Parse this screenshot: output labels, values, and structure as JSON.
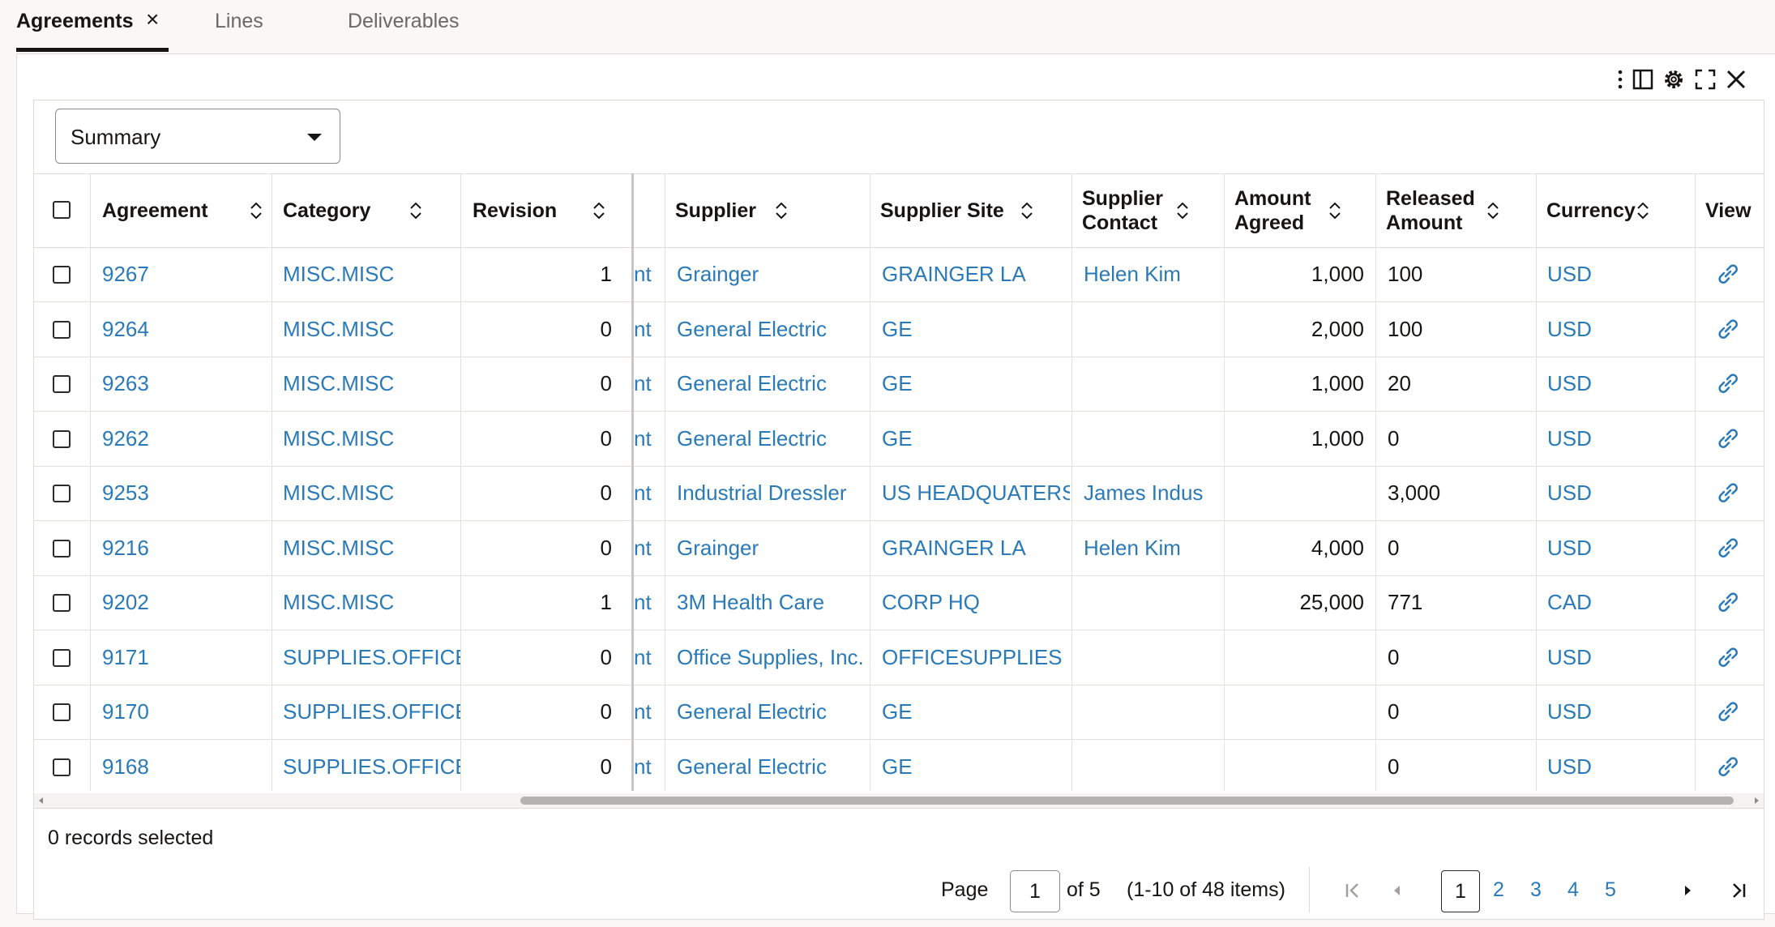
{
  "tabs": [
    {
      "label": "Agreements"
    },
    {
      "label": "Lines"
    },
    {
      "label": "Deliverables"
    }
  ],
  "tab_close_glyph": "×",
  "toolbar_icons": [
    "more-vert-icon",
    "panel-toggle-icon",
    "settings-gear-icon",
    "fullscreen-icon",
    "close-icon"
  ],
  "view_select": {
    "value": "Summary"
  },
  "columns": [
    {
      "key": "agreement",
      "label": "Agreement"
    },
    {
      "key": "category",
      "label": "Category"
    },
    {
      "key": "revision",
      "label": "Revision"
    },
    {
      "key": "partial",
      "label": ""
    },
    {
      "key": "supplier",
      "label": "Supplier"
    },
    {
      "key": "supplier_site",
      "label": "Supplier Site"
    },
    {
      "key": "supplier_contact",
      "label": "Supplier Contact"
    },
    {
      "key": "amount_agreed",
      "label": "Amount Agreed"
    },
    {
      "key": "released_amount",
      "label": "Released Amount"
    },
    {
      "key": "currency",
      "label": "Currency"
    },
    {
      "key": "view",
      "label": "View"
    }
  ],
  "rows": [
    {
      "agreement": "9267",
      "category": "MISC.MISC",
      "revision": "1",
      "partial": "nt",
      "supplier": "Grainger",
      "supplier_site": "GRAINGER LA",
      "supplier_contact": "Helen Kim",
      "amount_agreed": "1,000",
      "released_amount": "100",
      "currency": "USD"
    },
    {
      "agreement": "9264",
      "category": "MISC.MISC",
      "revision": "0",
      "partial": "nt",
      "supplier": "General Electric",
      "supplier_site": "GE",
      "supplier_contact": "",
      "amount_agreed": "2,000",
      "released_amount": "100",
      "currency": "USD"
    },
    {
      "agreement": "9263",
      "category": "MISC.MISC",
      "revision": "0",
      "partial": "nt",
      "supplier": "General Electric",
      "supplier_site": "GE",
      "supplier_contact": "",
      "amount_agreed": "1,000",
      "released_amount": "20",
      "currency": "USD"
    },
    {
      "agreement": "9262",
      "category": "MISC.MISC",
      "revision": "0",
      "partial": "nt",
      "supplier": "General Electric",
      "supplier_site": "GE",
      "supplier_contact": "",
      "amount_agreed": "1,000",
      "released_amount": "0",
      "currency": "USD"
    },
    {
      "agreement": "9253",
      "category": "MISC.MISC",
      "revision": "0",
      "partial": "nt",
      "supplier": "Industrial Dressler",
      "supplier_site": "US HEADQUATERS",
      "supplier_contact": "James Indus",
      "amount_agreed": "",
      "released_amount": "3,000",
      "currency": "USD"
    },
    {
      "agreement": "9216",
      "category": "MISC.MISC",
      "revision": "0",
      "partial": "nt",
      "supplier": "Grainger",
      "supplier_site": "GRAINGER LA",
      "supplier_contact": "Helen Kim",
      "amount_agreed": "4,000",
      "released_amount": "0",
      "currency": "USD"
    },
    {
      "agreement": "9202",
      "category": "MISC.MISC",
      "revision": "1",
      "partial": "nt",
      "supplier": "3M Health Care",
      "supplier_site": "CORP HQ",
      "supplier_contact": "",
      "amount_agreed": "25,000",
      "released_amount": "771",
      "currency": "CAD"
    },
    {
      "agreement": "9171",
      "category": "SUPPLIES.OFFICE",
      "revision": "0",
      "partial": "nt",
      "supplier": "Office Supplies, Inc.",
      "supplier_site": "OFFICESUPPLIES",
      "supplier_contact": "",
      "amount_agreed": "",
      "released_amount": "0",
      "currency": "USD"
    },
    {
      "agreement": "9170",
      "category": "SUPPLIES.OFFICE",
      "revision": "0",
      "partial": "nt",
      "supplier": "General Electric",
      "supplier_site": "GE",
      "supplier_contact": "",
      "amount_agreed": "",
      "released_amount": "0",
      "currency": "USD"
    },
    {
      "agreement": "9168",
      "category": "SUPPLIES.OFFICE",
      "revision": "0",
      "partial": "nt",
      "supplier": "General Electric",
      "supplier_site": "GE",
      "supplier_contact": "",
      "amount_agreed": "",
      "released_amount": "0",
      "currency": "USD"
    }
  ],
  "footer": {
    "records_selected": "0 records selected",
    "page_label": "Page",
    "page_value": "1",
    "page_of": "of 5",
    "items_range": "(1-10 of 48 items)",
    "pages": [
      "1",
      "2",
      "3",
      "4",
      "5"
    ]
  },
  "colors": {
    "link": "#2a7ab8",
    "text": "#161513",
    "background": "#f9f8f6"
  }
}
